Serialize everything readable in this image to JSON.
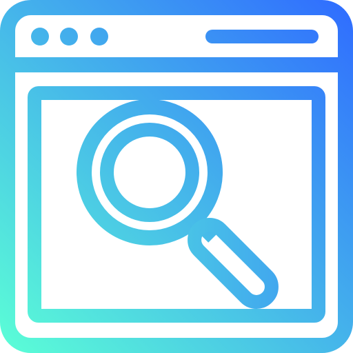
{
  "icon": {
    "name": "browser-search-icon",
    "window_dots_count": 3,
    "gradient": {
      "start": "#5BFFD6",
      "end": "#2F6BFF"
    }
  }
}
